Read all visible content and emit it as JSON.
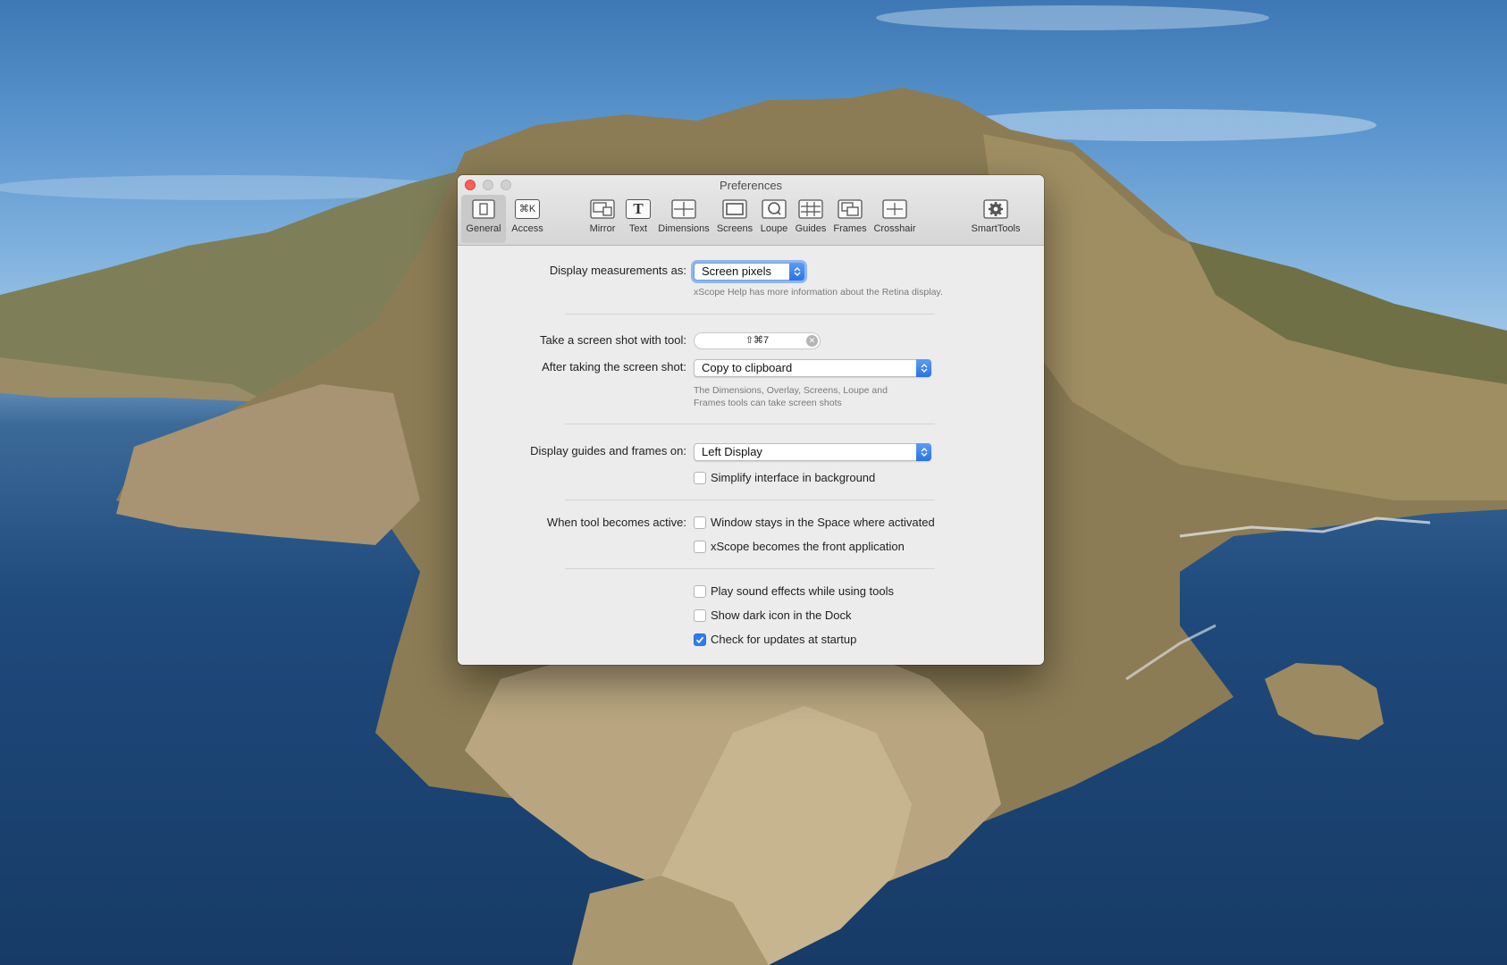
{
  "window": {
    "title": "Preferences"
  },
  "toolbar": {
    "items": [
      {
        "label": "General",
        "icon": "general-icon",
        "selected": true
      },
      {
        "label": "Access",
        "icon": "keyboard-shortcut-icon",
        "glyph": "⌘K"
      },
      {
        "label": "Mirror",
        "icon": "mirror-icon"
      },
      {
        "label": "Text",
        "icon": "text-icon",
        "glyph": "T"
      },
      {
        "label": "Dimensions",
        "icon": "dimensions-icon"
      },
      {
        "label": "Screens",
        "icon": "screens-icon"
      },
      {
        "label": "Loupe",
        "icon": "loupe-icon"
      },
      {
        "label": "Guides",
        "icon": "guides-icon"
      },
      {
        "label": "Frames",
        "icon": "frames-icon"
      },
      {
        "label": "Crosshair",
        "icon": "crosshair-icon"
      },
      {
        "label": "SmartTools",
        "icon": "gear-icon"
      }
    ]
  },
  "display_measurements": {
    "label": "Display measurements as:",
    "value": "Screen pixels",
    "hint": "xScope Help has more information about the Retina display."
  },
  "screenshot": {
    "tool_label": "Take a screen shot with tool:",
    "shortcut": "⇧⌘7",
    "after_label": "After taking the screen shot:",
    "after_value": "Copy to clipboard",
    "hint_line1": "The Dimensions, Overlay, Screens, Loupe and",
    "hint_line2": "Frames tools can take screen shots"
  },
  "guides": {
    "label": "Display guides and frames on:",
    "value": "Left Display",
    "simplify_label": "Simplify interface in background",
    "simplify_checked": false
  },
  "tool_active": {
    "label": "When tool becomes active:",
    "options": [
      {
        "label": "Window stays in the Space where activated",
        "checked": false
      },
      {
        "label": "xScope becomes the front application",
        "checked": false
      }
    ]
  },
  "misc": {
    "options": [
      {
        "label": "Play sound effects while using tools",
        "checked": false
      },
      {
        "label": "Show dark icon in the Dock",
        "checked": false
      },
      {
        "label": "Check for updates at startup",
        "checked": true
      }
    ]
  },
  "colors": {
    "accent": "#2f7bf5",
    "close_button": "#ff5f57"
  }
}
